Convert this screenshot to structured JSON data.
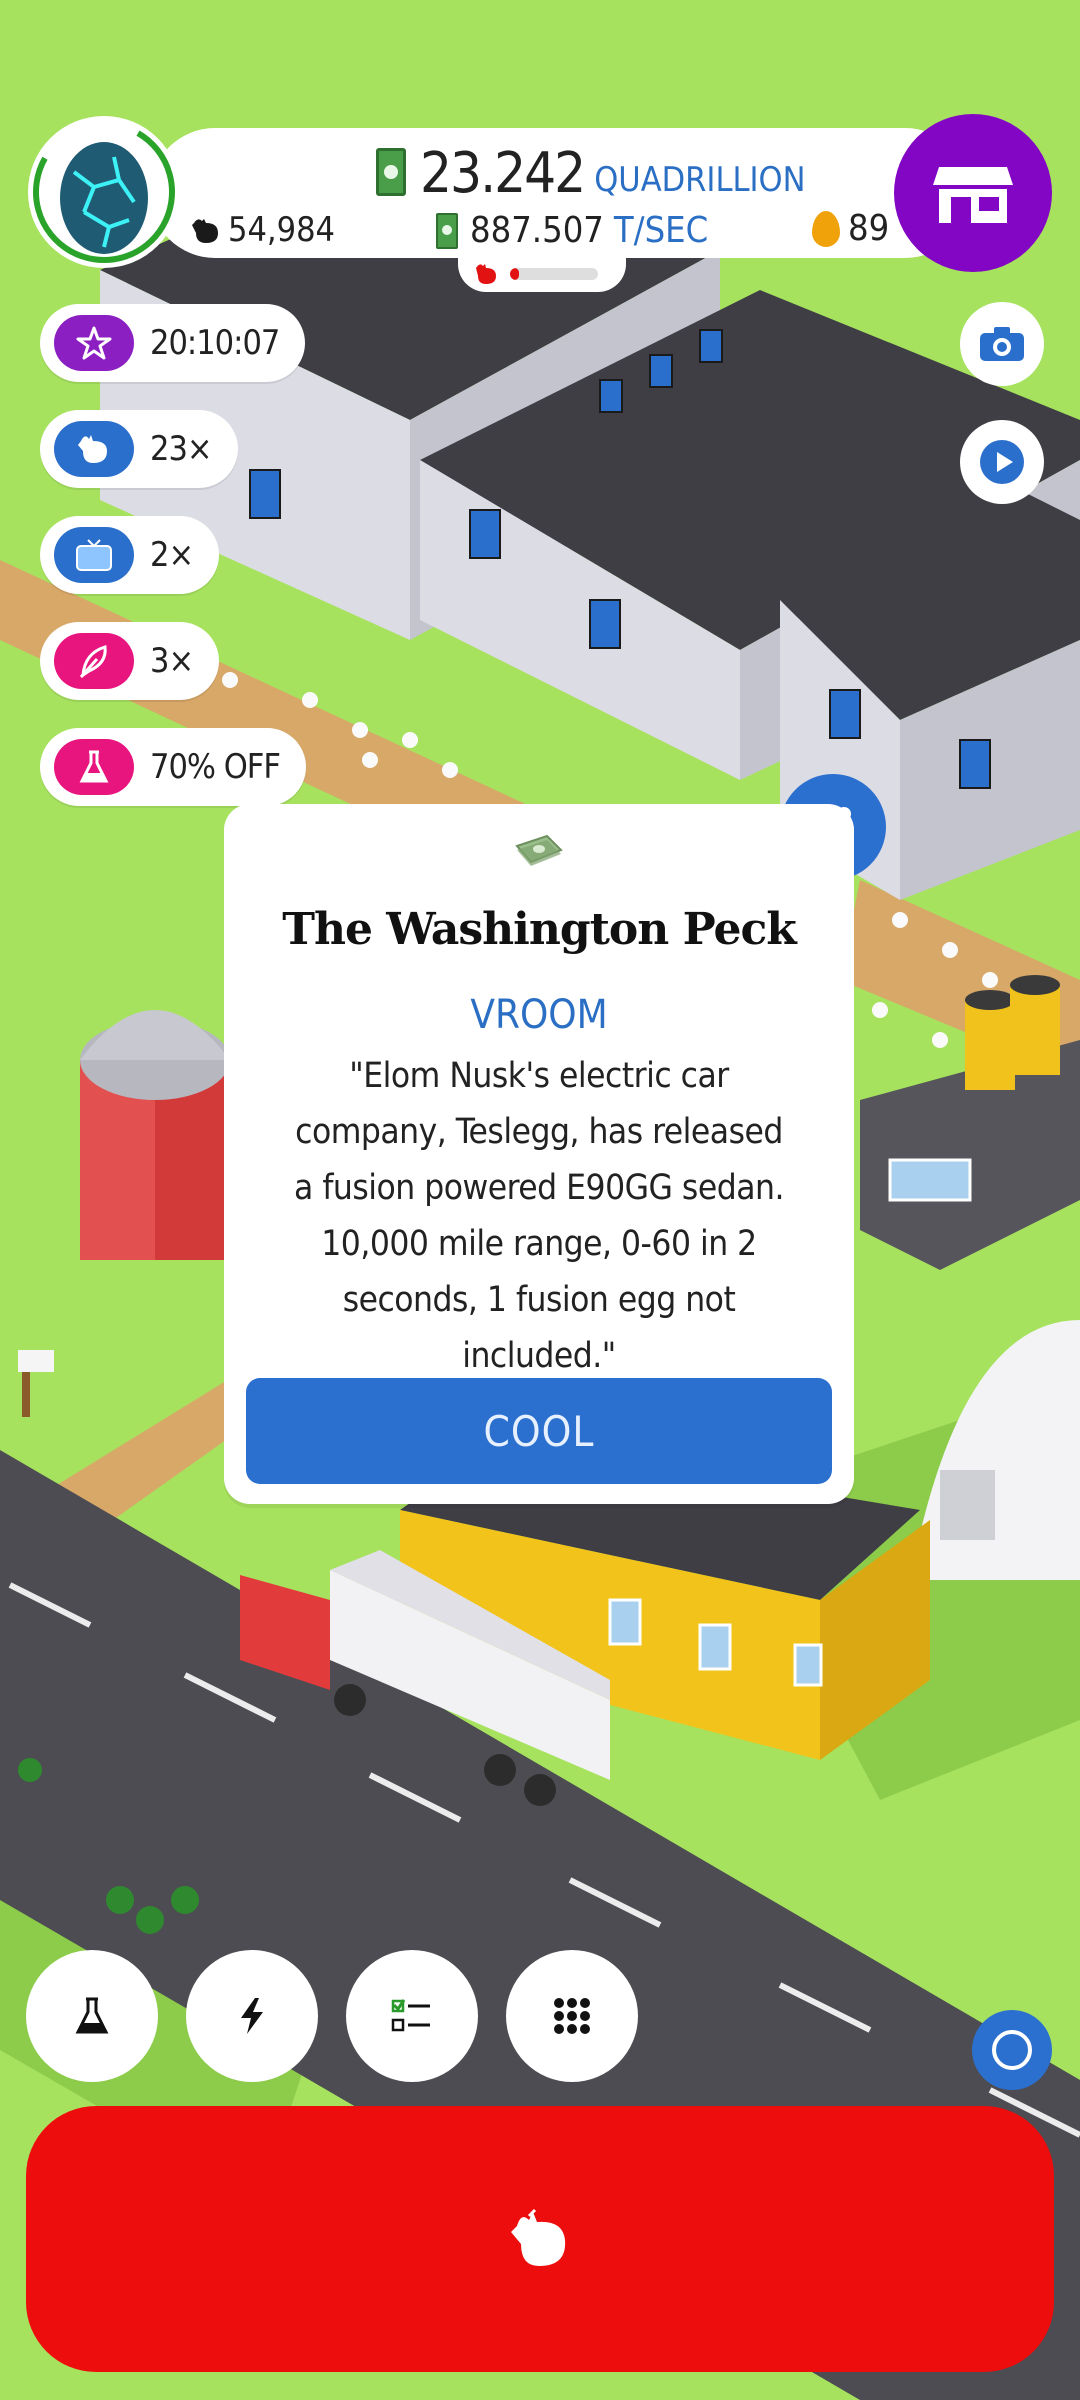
{
  "header": {
    "money_value": "23.242",
    "money_unit": "QUADRILLION",
    "chickens": "54,984",
    "rate_value": "887.507",
    "rate_unit": "T/SEC",
    "golden_eggs": "89"
  },
  "boosts": [
    {
      "icon": "star-icon",
      "text": "20:10:07",
      "color": "#8b1fc2"
    },
    {
      "icon": "chicken-icon",
      "text": "23×",
      "color": "#2a6fcc"
    },
    {
      "icon": "tv-icon",
      "text": "2×",
      "color": "#2a6fcc"
    },
    {
      "icon": "feather-icon",
      "text": "3×",
      "color": "#e8157f"
    },
    {
      "icon": "flask-icon",
      "text": "70% OFF",
      "color": "#e8157f"
    }
  ],
  "progress": {
    "value": 0.1
  },
  "news": {
    "publication": "The Washington Peck",
    "headline": "VROOM",
    "body": "\"Elom Nusk's electric car company, Teslegg, has released a fusion powered E90GG sedan. 10,000 mile range, 0-60 in 2 seconds, 1 fusion egg not included.\"",
    "button": "COOL"
  },
  "colors": {
    "grass": "#a7e25f",
    "shop": "#8206c4",
    "accent_blue": "#2c70cf",
    "hatch": "#ee0d0d"
  }
}
